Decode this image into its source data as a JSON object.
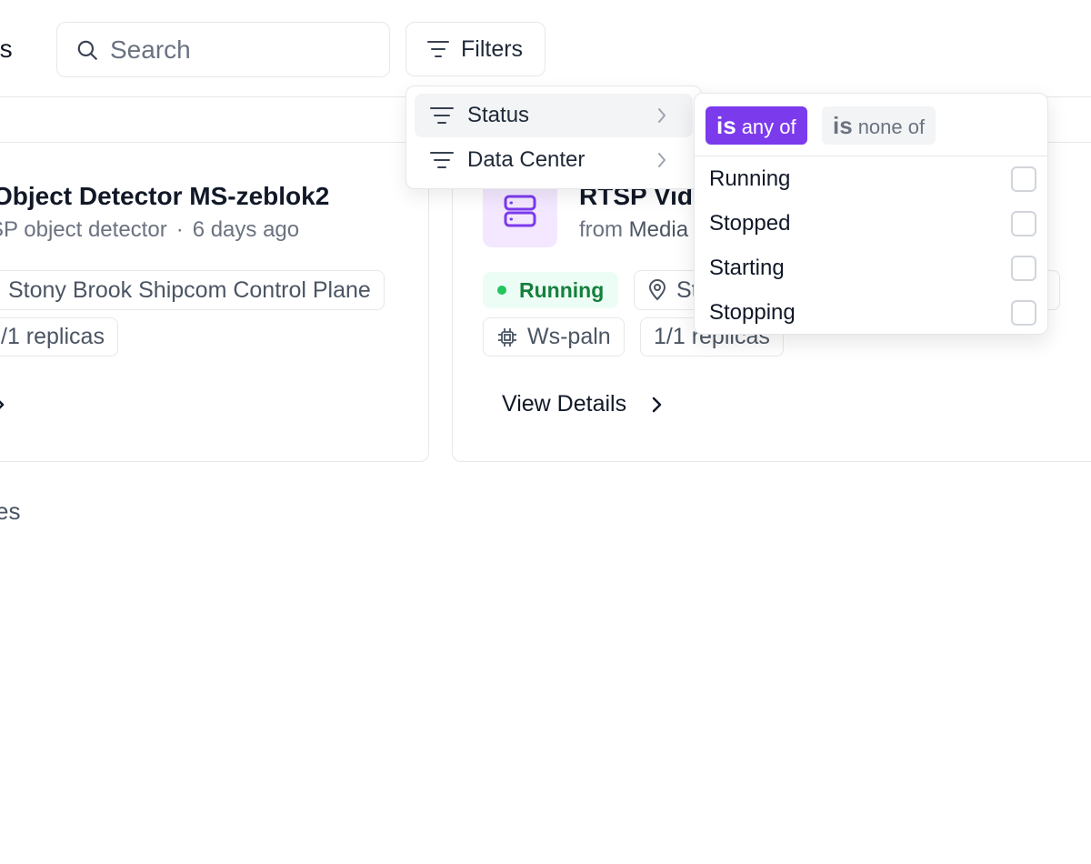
{
  "page": {
    "title_partial": "ces",
    "section_footer_partial": "ces"
  },
  "search": {
    "placeholder": "Search"
  },
  "filters": {
    "label": "Filters"
  },
  "filter_menu": {
    "items": [
      {
        "label": "Status",
        "icon": "filter-lines-icon",
        "active": true
      },
      {
        "label": "Data Center",
        "icon": "filter-lines-icon",
        "active": false
      }
    ]
  },
  "status_submenu": {
    "operators": [
      {
        "prefix": "is",
        "text": "any of",
        "selected": true
      },
      {
        "prefix": "is",
        "text": "none of",
        "selected": false
      }
    ],
    "options": [
      {
        "label": "Running",
        "checked": false
      },
      {
        "label": "Stopped",
        "checked": false
      },
      {
        "label": "Starting",
        "checked": false
      },
      {
        "label": "Stopping",
        "checked": false
      }
    ]
  },
  "cards": [
    {
      "title": "Object Detector MS-zeblok2",
      "subtitle": "SP object detector",
      "age": "6 days ago",
      "data_center": "Stony Brook Shipcom Control Plane",
      "replicas": "/1 replicas"
    },
    {
      "title": "RTSP Vid",
      "subtitle_prefix": "from",
      "subtitle_source": "Media",
      "status": "Running",
      "location": "St",
      "node": "Ws-paln",
      "replicas": "1/1 replicas",
      "view_details": "View Details"
    }
  ],
  "colors": {
    "accent": "#7c3aed",
    "running_bg": "#ecfdf5",
    "running_text": "#15803d",
    "running_dot": "#22c55e",
    "border": "#e5e7eb"
  }
}
